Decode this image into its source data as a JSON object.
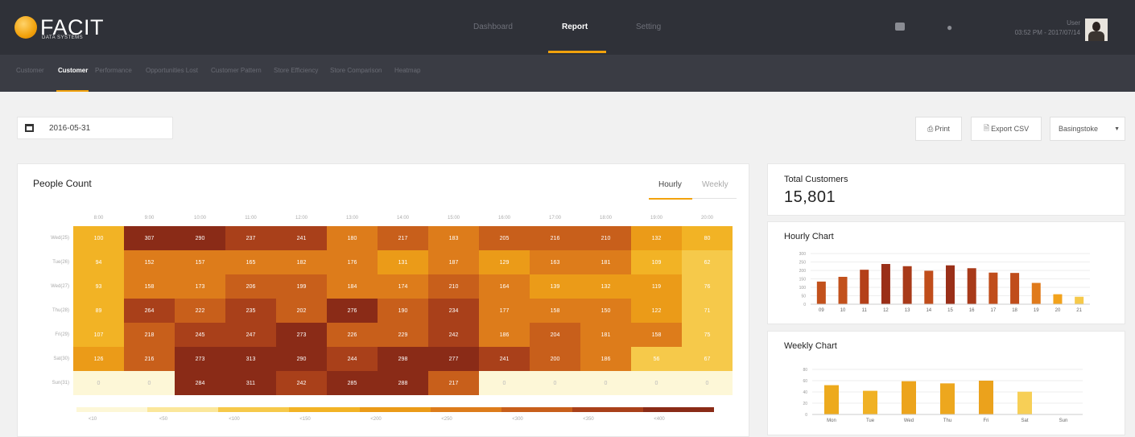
{
  "app": {
    "logo_text": "FACIT",
    "logo_sub": "DATA SYSTEMS"
  },
  "nav": {
    "tabs": [
      "Dashboard",
      "Report",
      "Setting"
    ],
    "active": "Report"
  },
  "user": {
    "name": "User",
    "datetime": "03:52 PM - 2017/07/14"
  },
  "subnav": {
    "items": [
      "Customer",
      "Customer",
      "Performance",
      "Opportunities Lost",
      "Customer Pattern",
      "Store Efficiency",
      "Store Comparison",
      "Heatmap"
    ],
    "active_index": 1
  },
  "filters": {
    "date": "2016-05-31",
    "print_label": "Print",
    "export_label": "Export CSV",
    "store": "Basingstoke"
  },
  "people_count": {
    "title": "People Count",
    "tabs": [
      "Hourly",
      "Weekly"
    ],
    "active_tab": "Hourly",
    "columns": [
      "8:00",
      "9:00",
      "10:00",
      "11:00",
      "12:00",
      "13:00",
      "14:00",
      "15:00",
      "16:00",
      "17:00",
      "18:00",
      "19:00",
      "20:00"
    ],
    "rows": [
      {
        "label": "Wed(25)",
        "values": [
          "100",
          "307",
          "290",
          "237",
          "241",
          "180",
          "217",
          "183",
          "205",
          "216",
          "210",
          "132",
          "80"
        ]
      },
      {
        "label": "Tue(26)",
        "values": [
          "94",
          "152",
          "157",
          "165",
          "182",
          "176",
          "131",
          "187",
          "129",
          "163",
          "181",
          "109",
          "62"
        ]
      },
      {
        "label": "Wed(27)",
        "values": [
          "93",
          "158",
          "173",
          "206",
          "199",
          "184",
          "174",
          "210",
          "164",
          "139",
          "132",
          "119",
          "76"
        ]
      },
      {
        "label": "Thu(28)",
        "values": [
          "89",
          "264",
          "222",
          "235",
          "202",
          "276",
          "190",
          "234",
          "177",
          "158",
          "150",
          "122",
          "71"
        ]
      },
      {
        "label": "Fri(29)",
        "values": [
          "107",
          "218",
          "245",
          "247",
          "273",
          "226",
          "229",
          "242",
          "186",
          "204",
          "181",
          "158",
          "75"
        ]
      },
      {
        "label": "Sat(30)",
        "values": [
          "126",
          "216",
          "273",
          "313",
          "290",
          "244",
          "298",
          "277",
          "241",
          "200",
          "186",
          "56",
          "67"
        ]
      },
      {
        "label": "Sun(31)",
        "values": [
          "0",
          "0",
          "284",
          "311",
          "242",
          "285",
          "288",
          "217",
          "0",
          "0",
          "0",
          "0",
          "0"
        ]
      }
    ],
    "levels": [
      0,
      0.1,
      0.2,
      0.3,
      0.4,
      0.5,
      0.6,
      0.75,
      0.9,
      1.0
    ],
    "legend": [
      "<10",
      "<50",
      "<100",
      "<150",
      "<200",
      "<250",
      "<300",
      "<350",
      "<400"
    ],
    "colors": {
      "c0": "#fdf7d7",
      "c1": "#fbe79b",
      "c2": "#f6c94a",
      "c3": "#f2b325",
      "c4": "#eb9b18",
      "c5": "#dd7c1b",
      "c6": "#c85f1b",
      "c7": "#a9401a",
      "c8": "#8a2b17"
    }
  },
  "total": {
    "label": "Total Customers",
    "value": "15,801"
  },
  "hourly_chart": {
    "title": "Hourly Chart",
    "chart_data": {
      "type": "bar",
      "categories": [
        "09",
        "10",
        "11",
        "12",
        "13",
        "14",
        "15",
        "16",
        "17",
        "18",
        "19",
        "20",
        "21"
      ],
      "values": [
        1340,
        1620,
        2040,
        2380,
        2250,
        1980,
        2300,
        2130,
        1870,
        1850,
        1260,
        590,
        440
      ],
      "colors": [
        "#c2511c",
        "#c2511c",
        "#b44019",
        "#9a2f18",
        "#a83a19",
        "#c04d1b",
        "#9a2f18",
        "#a83a19",
        "#c04d1b",
        "#c04d1b",
        "#e07a1b",
        "#f2a21c",
        "#f6c94a"
      ],
      "ylim": [
        0,
        3000
      ],
      "yticks": [
        "0",
        "50",
        "100",
        "150",
        "200",
        "250",
        "300"
      ]
    }
  },
  "weekly_chart": {
    "title": "Weekly Chart",
    "chart_data": {
      "type": "bar",
      "categories": [
        "Mon",
        "Tue",
        "Wed",
        "Thu",
        "Fri",
        "Sat",
        "Sun"
      ],
      "values": [
        2600,
        2100,
        2950,
        2760,
        3000,
        2020,
        0
      ],
      "colors": [
        "#edaa1d",
        "#f0b124",
        "#eca41c",
        "#eda71e",
        "#eba21c",
        "#f7cf56",
        "#f7cf56"
      ],
      "ylim": [
        0,
        4000
      ],
      "yticks": [
        "0",
        "20",
        "40",
        "60",
        "80"
      ]
    }
  }
}
